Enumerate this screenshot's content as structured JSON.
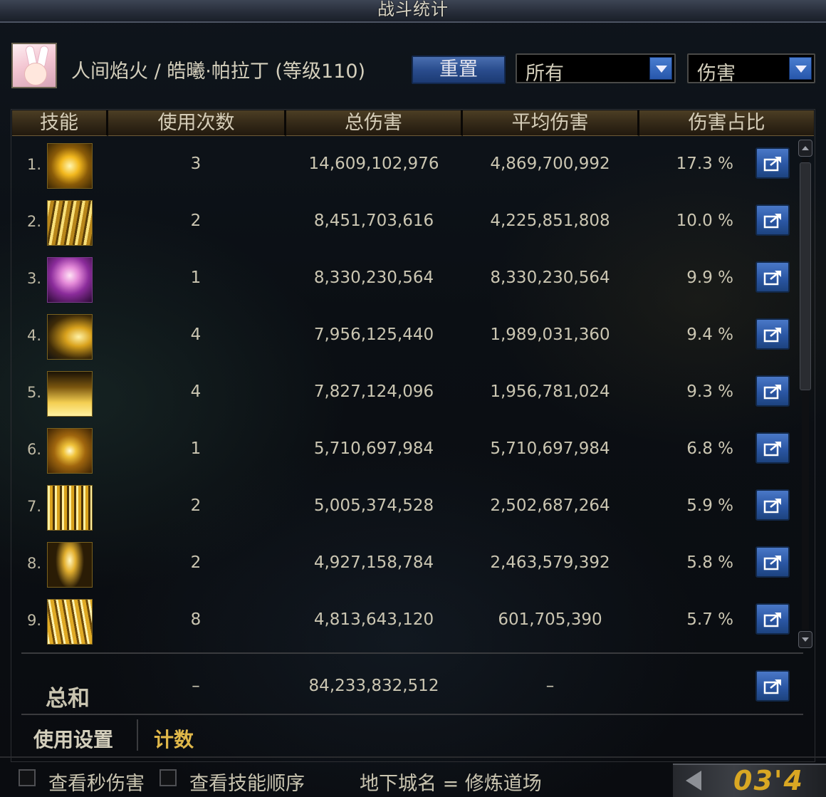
{
  "window": {
    "title": "战斗统计"
  },
  "character": {
    "name": "人间焰火 / 皓曦·帕拉丁 (等级110)"
  },
  "controls": {
    "reset_label": "重置",
    "filter_selected": "所有",
    "metric_selected": "伤害"
  },
  "table": {
    "headers": [
      "技能",
      "使用次数",
      "总伤害",
      "平均伤害",
      "伤害占比"
    ],
    "rows": [
      {
        "index": "1.",
        "uses": "3",
        "total": "14,609,102,976",
        "avg": "4,869,700,992",
        "pct": "17.3 %"
      },
      {
        "index": "2.",
        "uses": "2",
        "total": "8,451,703,616",
        "avg": "4,225,851,808",
        "pct": "10.0 %"
      },
      {
        "index": "3.",
        "uses": "1",
        "total": "8,330,230,564",
        "avg": "8,330,230,564",
        "pct": "9.9 %"
      },
      {
        "index": "4.",
        "uses": "4",
        "total": "7,956,125,440",
        "avg": "1,989,031,360",
        "pct": "9.4 %"
      },
      {
        "index": "5.",
        "uses": "4",
        "total": "7,827,124,096",
        "avg": "1,956,781,024",
        "pct": "9.3 %"
      },
      {
        "index": "6.",
        "uses": "1",
        "total": "5,710,697,984",
        "avg": "5,710,697,984",
        "pct": "6.8 %"
      },
      {
        "index": "7.",
        "uses": "2",
        "total": "5,005,374,528",
        "avg": "2,502,687,264",
        "pct": "5.9 %"
      },
      {
        "index": "8.",
        "uses": "2",
        "total": "4,927,158,784",
        "avg": "2,463,579,392",
        "pct": "5.8 %"
      },
      {
        "index": "9.",
        "uses": "8",
        "total": "4,813,643,120",
        "avg": "601,705,390",
        "pct": "5.7 %"
      }
    ],
    "totals": {
      "label": "总和",
      "uses": "–",
      "total": "84,233,832,512",
      "avg": "–"
    }
  },
  "tabs": {
    "settings_label": "使用设置",
    "count_label": "计数"
  },
  "footer": {
    "per_second_label": "查看秒伤害",
    "skill_order_label": "查看技能顺序",
    "dungeon_label": "地下城名 = 修炼道场",
    "timer": "03'4"
  },
  "colors": {
    "accent_gold": "#e0b84a",
    "button_blue": "#2a56a3"
  }
}
